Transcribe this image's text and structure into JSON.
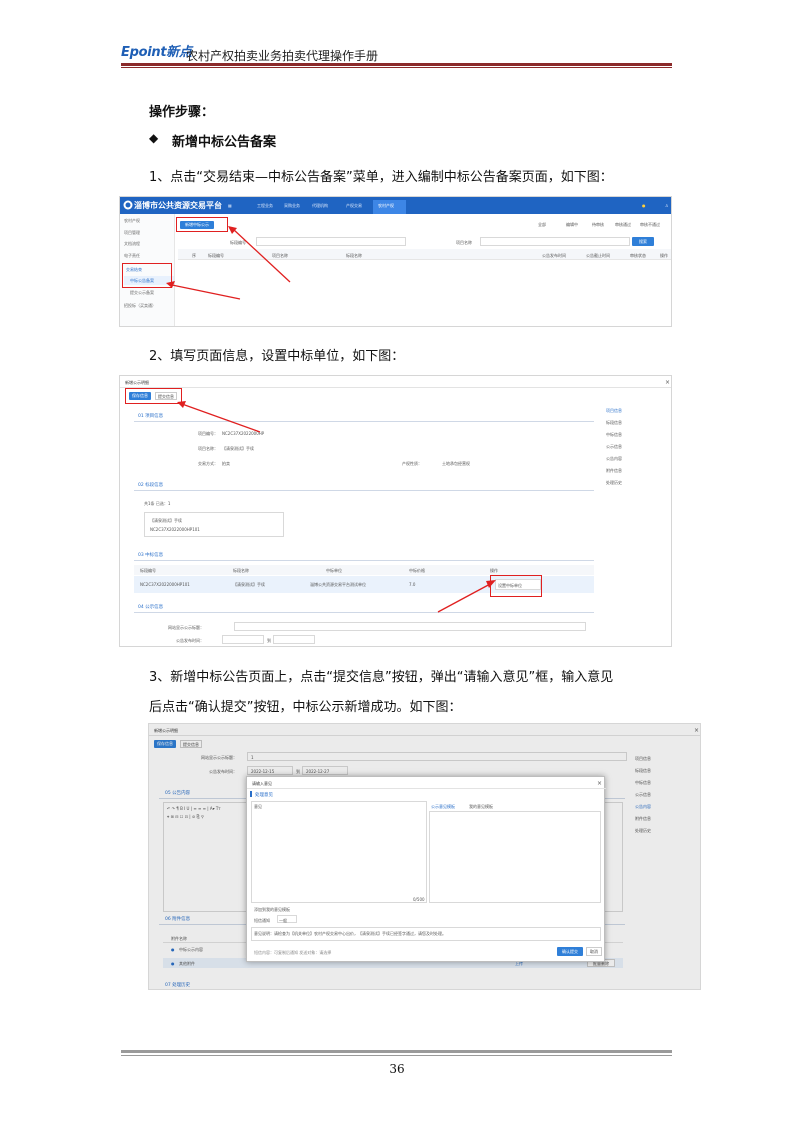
{
  "header": {
    "logo": "Epoint",
    "logo_cn": "新点",
    "title": "农村产权拍卖业务拍卖代理操作手册"
  },
  "steps_heading": "操作步骤：",
  "section_heading": "新增中标公告备案",
  "step1": "1、点击“交易结束—中标公告备案”菜单，进入编制中标公告备案页面，如下图：",
  "step2": "2、填写页面信息，设置中标单位，如下图：",
  "step3_line1": "3、新增中标公告页面上，点击“提交信息”按钮，弹出“请输入意见”框，输入意见",
  "step3_line2": "后点击“确认提交”按钮，中标公示新增成功。如下图：",
  "shot1": {
    "platform_title": "淄博市公共资源交易平台",
    "top_tabs": [
      "工程业务",
      "采购业务",
      "代理机构",
      "产权交易",
      "农村产权"
    ],
    "sidebar": [
      "农村产权",
      "项目管理",
      "文档流程",
      "电子责任",
      "交易结束",
      "中标公告备案",
      "提交公示备案",
      "招投标（买卖通）"
    ],
    "add_button": "新增中标公示",
    "filters": [
      "标段编号",
      "项目名称"
    ],
    "search_button": "搜索",
    "columns": [
      "序",
      "标段编号",
      "项目名称",
      "标段名称",
      "公告发布时间",
      "公告截止时间",
      "审核状态",
      "操作"
    ],
    "status_radios": [
      "全部",
      "编辑中",
      "待审核",
      "审核通过",
      "审核不通过"
    ]
  },
  "shot2": {
    "window_title": "新增公示明细",
    "tabs": [
      "保存信息",
      "提交信息"
    ],
    "sec1_title": "01 项目信息",
    "sec1_fields": [
      {
        "label": "项目编号：",
        "value": "NC2C37X2022000HP"
      },
      {
        "label": "项目名称：",
        "value": "【清泉测试】手续"
      },
      {
        "label": "交易方式：",
        "value": "拍卖"
      }
    ],
    "trade_type_label": "产权性质：",
    "trade_type_value": "土地承包经营权",
    "sec2_title": "02 标段信息",
    "sec2_count": "共1条  已选：1",
    "sec2_item_name": "【清泉测试】手续",
    "sec2_item_code": "NC2C37X2022000HP101",
    "sec3_title": "03 中标信息",
    "sec3_columns": [
      "标段编号",
      "标段名称",
      "中标单位",
      "中标价格",
      "操作"
    ],
    "sec3_row": [
      "NC2C37X2022000HP101",
      "【清泉测试】手续",
      "淄博公共资源交易平台测试单位",
      "7.0",
      "设置中标单位"
    ],
    "sec4_title": "04 公示信息",
    "sec4_fields": [
      "网站显示公示标题：",
      "公告发布时间："
    ],
    "date_to": "到",
    "right_nav": [
      "项目信息",
      "标段信息",
      "中标信息",
      "公示信息",
      "公告内容",
      "附件信息",
      "处理历史"
    ]
  },
  "shot3": {
    "window_title": "新增公示明细",
    "tabs": [
      "保存信息",
      "提交信息"
    ],
    "title_label": "网站显示公示标题：",
    "title_value": "1",
    "date_label": "公告发布时间：",
    "date_start": "2022-12-15",
    "date_to": "到",
    "date_end": "2022-12-27",
    "sec5_title": "05 公告内容",
    "sec6_title": "06 附件信息",
    "attach_header": "附件名称",
    "attach_rows": [
      "中标公示内容",
      "其他附件"
    ],
    "upload": "上传",
    "delete_all": "批量删除",
    "sec7_title": "07 处理历史",
    "right_nav": [
      "项目信息",
      "标段信息",
      "中标信息",
      "公示信息",
      "公告内容",
      "附件信息",
      "处理历史"
    ],
    "modal": {
      "title": "请输入意见",
      "section": "处理意见",
      "textarea_label": "意见",
      "tabs": [
        "公示意见模板",
        "我的意见模板"
      ],
      "counter": "0/500",
      "save_template": "添加到我的意见模板",
      "short_msg_label": "短信通知",
      "short_msg_value": "一般",
      "info_text": "意见说明：请检查为【机关单位】农村产权交易中心出价，【清泉测试】手续已经签字通过，请您及时处理。",
      "footer_info": "短信内容：可复制后通知    发送对象：请选择",
      "confirm": "确认提交",
      "cancel": "取消"
    }
  },
  "page_number": "36"
}
